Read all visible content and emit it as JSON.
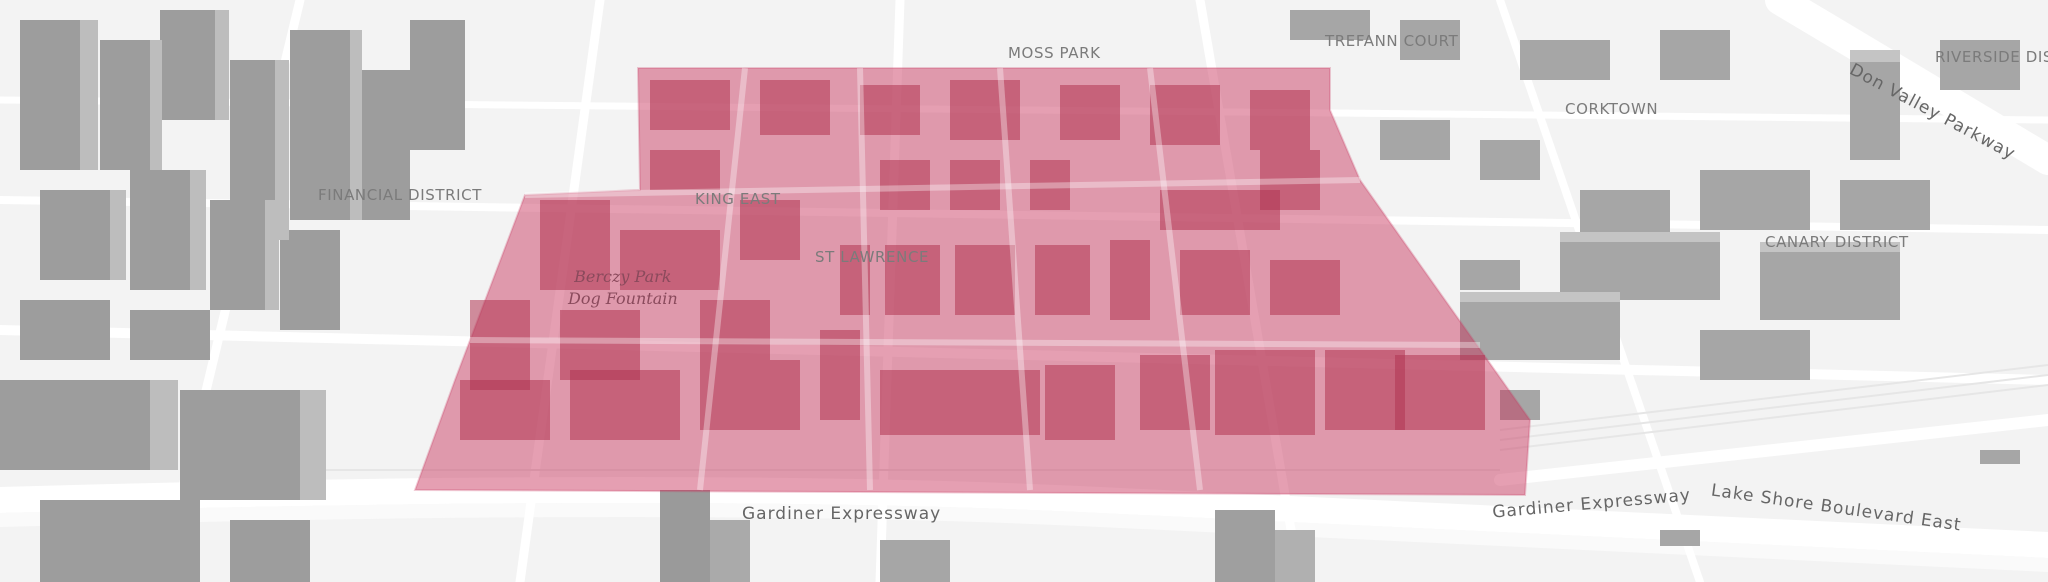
{
  "map": {
    "view": "3d-perspective",
    "highlight_color": "#c9375f",
    "building_color": "#9a9a9a",
    "ground_color": "#f3f3f3",
    "road_color": "#ffffff"
  },
  "labels": {
    "moss_park": "MOSS PARK",
    "corktown": "CORKTOWN",
    "financial_district": "FINANCIAL DISTRICT",
    "king_east": "KING EAST",
    "st_lawrence": "ST LAWRENCE",
    "canary_district": "CANARY DISTRICT",
    "riverside": "RIVERSIDE DIS",
    "trefann": "TREFANN COURT",
    "park_line1": "Berczy Park",
    "park_line2": "Dog Fountain",
    "gardiner_1": "Gardiner Expressway",
    "gardiner_2": "Gardiner Expressway",
    "lakeshore": "Lake Shore Boulevard East",
    "dvp": "Don Valley Parkway"
  }
}
